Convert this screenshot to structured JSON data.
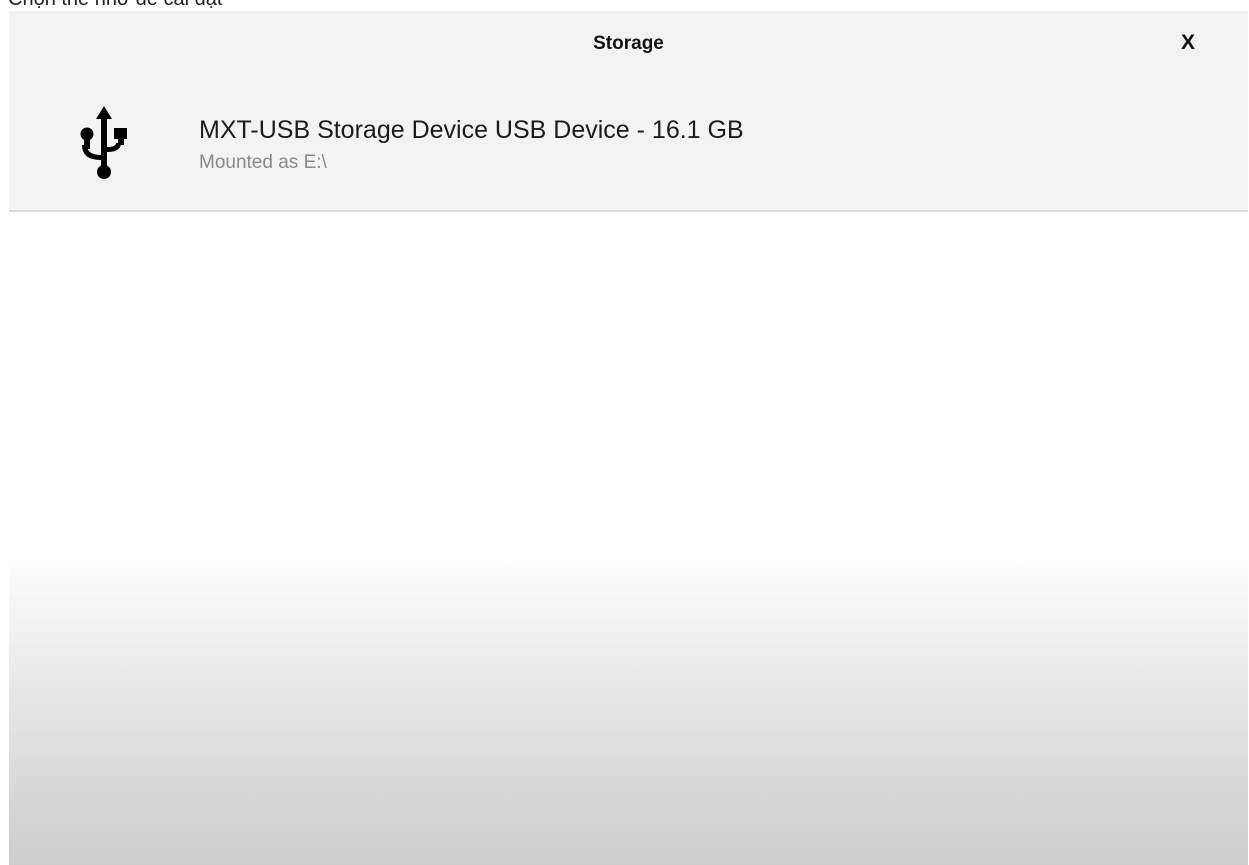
{
  "caption": "Chọn thẻ nhớ để cài đặt",
  "dialog": {
    "title": "Storage",
    "close_label": "X"
  },
  "devices": [
    {
      "name": "MXT-USB Storage Device USB Device - 16.1 GB",
      "status": "Mounted as E:\\",
      "icon": "usb-icon"
    }
  ],
  "colors": {
    "header_bg": "#f3f3f3",
    "body_bg": "#ffffff",
    "text_primary": "#1c1c1c",
    "text_secondary": "#8a8a8a"
  }
}
